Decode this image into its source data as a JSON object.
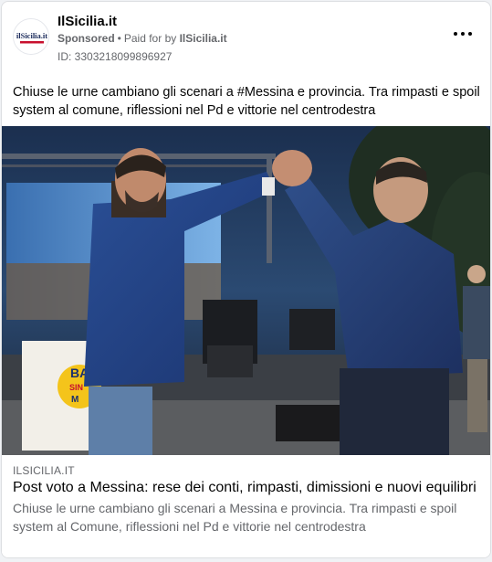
{
  "post": {
    "page_name": "IlSicilia.it",
    "sponsored_label": "Sponsored",
    "separator": "•",
    "paid_for_prefix": "Paid for by",
    "payer": "IlSicilia.it",
    "ad_id": "ID: 3303218099896927",
    "body": "Chiuse le urne cambiano gli scenari a #Messina e provincia. Tra rimpasti e spoil system al comune, riflessioni nel Pd e vittorie nel centrodestra",
    "avatar_text": "ilSicilia.it"
  },
  "link": {
    "domain": "ILSICILIA.IT",
    "title": "Post voto a Messina: rese dei conti, rimpasti, dimissioni e nuovi equilibri",
    "description": "Chiuse le urne cambiano gli scenari a Messina e provincia. Tra rimpasti e spoil system al Comune, riflessioni nel Pd e vittorie nel centrodestra"
  },
  "photo": {
    "banner_text_1": "BA",
    "banner_text_2": "SIN",
    "banner_text_3": "M"
  },
  "icons": {
    "more": "more-options-icon"
  },
  "colors": {
    "text_primary": "#050505",
    "text_secondary": "#65676b",
    "background": "#f0f2f5",
    "card": "#ffffff"
  }
}
